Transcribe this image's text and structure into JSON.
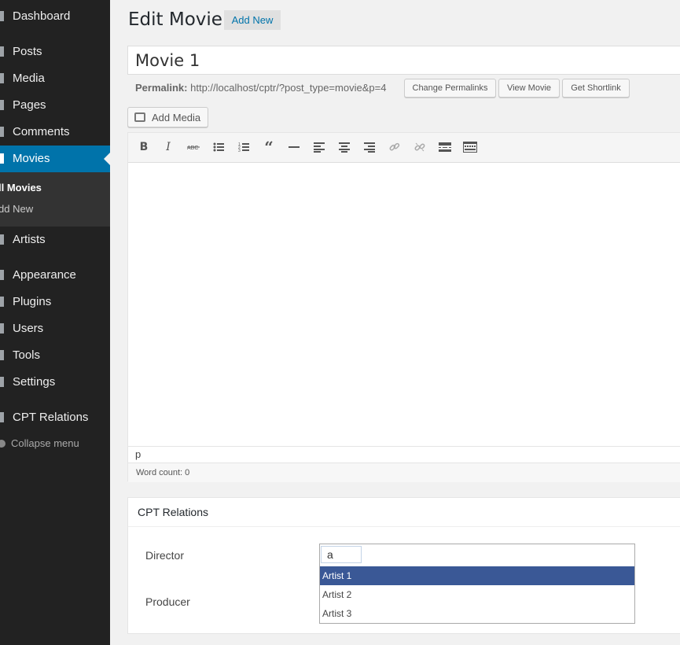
{
  "sidebar": {
    "items": [
      {
        "label": "Dashboard",
        "icon": "dashboard-icon"
      },
      {
        "label": "Posts",
        "icon": "pin-icon"
      },
      {
        "label": "Media",
        "icon": "media-icon"
      },
      {
        "label": "Pages",
        "icon": "pages-icon"
      },
      {
        "label": "Comments",
        "icon": "comments-icon"
      },
      {
        "label": "Movies",
        "icon": "pin-icon"
      },
      {
        "label": "Artists",
        "icon": "pin-icon"
      },
      {
        "label": "Appearance",
        "icon": "brush-icon"
      },
      {
        "label": "Plugins",
        "icon": "plugin-icon"
      },
      {
        "label": "Users",
        "icon": "users-icon"
      },
      {
        "label": "Tools",
        "icon": "wrench-icon"
      },
      {
        "label": "Settings",
        "icon": "settings-icon"
      },
      {
        "label": "CPT Relations",
        "icon": "generic-icon"
      }
    ],
    "submenu": [
      "ll Movies",
      "dd New"
    ],
    "collapse_label": "Collapse menu",
    "active_color": "#0073aa"
  },
  "header": {
    "title": "Edit Movie",
    "add_new": "Add New"
  },
  "post": {
    "title": "Movie 1",
    "permalink_label": "Permalink:",
    "permalink_url": "http://localhost/cptr/?post_type=movie&p=4",
    "buttons": {
      "change": "Change Permalinks",
      "view": "View Movie",
      "shortlink": "Get Shortlink"
    }
  },
  "editor": {
    "add_media": "Add Media",
    "toolbar": [
      "bold-icon",
      "italic-icon",
      "strikethrough-icon",
      "bullet-list-icon",
      "numbered-list-icon",
      "blockquote-icon",
      "horizontal-rule-icon",
      "align-left-icon",
      "align-center-icon",
      "align-right-icon",
      "link-icon",
      "unlink-icon",
      "read-more-icon",
      "toolbar-toggle-icon"
    ],
    "path": "p",
    "word_count": "Word count: 0"
  },
  "relations": {
    "title": "CPT Relations",
    "director_label": "Director",
    "producer_label": "Producer",
    "input_value": "a",
    "options": [
      "Artist 1",
      "Artist 2",
      "Artist 3"
    ],
    "highlight_color": "#3a5896"
  }
}
